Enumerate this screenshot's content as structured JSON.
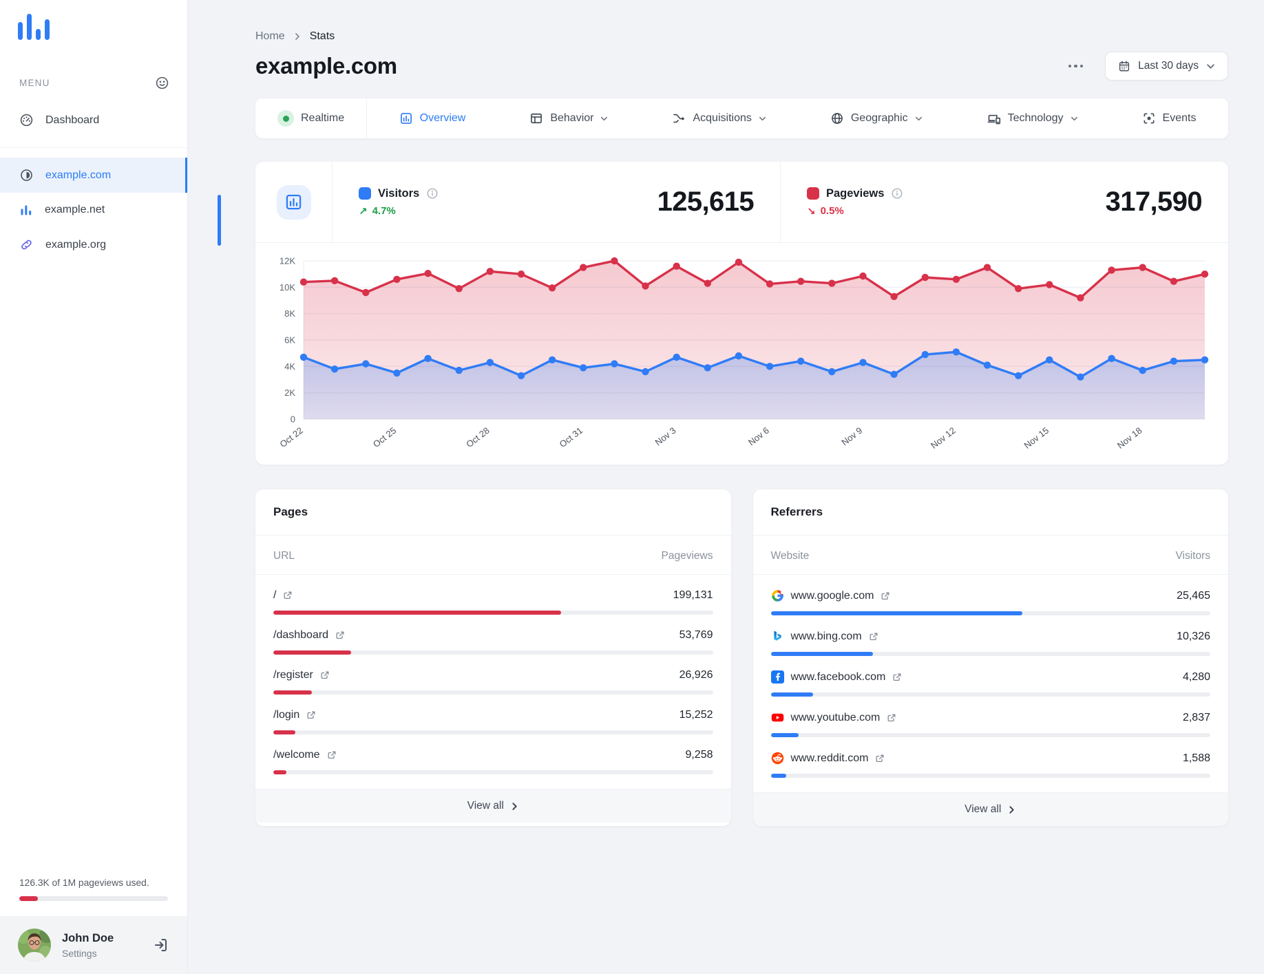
{
  "sidebar": {
    "menu_label": "MENU",
    "nav": [
      {
        "label": "Dashboard"
      }
    ],
    "sites": [
      {
        "label": "example.com",
        "active": true
      },
      {
        "label": "example.net",
        "active": false
      },
      {
        "label": "example.org",
        "active": false
      }
    ],
    "usage": {
      "text": "126.3K of 1M pageviews used.",
      "percent": 12.6
    },
    "user": {
      "name": "John Doe",
      "subtitle": "Settings"
    }
  },
  "header": {
    "breadcrumb": {
      "home": "Home",
      "current": "Stats"
    },
    "title": "example.com",
    "date_button": "Last 30 days"
  },
  "tabs": [
    {
      "label": "Realtime",
      "active": false
    },
    {
      "label": "Overview",
      "active": true
    },
    {
      "label": "Behavior",
      "active": false,
      "chevron": true
    },
    {
      "label": "Acquisitions",
      "active": false,
      "chevron": true
    },
    {
      "label": "Geographic",
      "active": false,
      "chevron": true
    },
    {
      "label": "Technology",
      "active": false,
      "chevron": true
    },
    {
      "label": "Events",
      "active": false
    }
  ],
  "stats": [
    {
      "label": "Visitors",
      "value": "125,615",
      "delta": "4.7%",
      "arrow": "↗",
      "trend": "up",
      "color": "#2f7cf6"
    },
    {
      "label": "Pageviews",
      "value": "317,590",
      "delta": "0.5%",
      "arrow": "↘",
      "trend": "down",
      "color": "#d8314a"
    }
  ],
  "chart_data": {
    "type": "line",
    "title": "Visitors vs Pageviews, last 30 days",
    "x": [
      "Oct 22",
      "Oct 23",
      "Oct 24",
      "Oct 25",
      "Oct 26",
      "Oct 27",
      "Oct 28",
      "Oct 29",
      "Oct 30",
      "Oct 31",
      "Nov 1",
      "Nov 2",
      "Nov 3",
      "Nov 4",
      "Nov 5",
      "Nov 6",
      "Nov 7",
      "Nov 8",
      "Nov 9",
      "Nov 10",
      "Nov 11",
      "Nov 12",
      "Nov 13",
      "Nov 14",
      "Nov 15",
      "Nov 16",
      "Nov 17",
      "Nov 18",
      "Nov 19",
      "Nov 20"
    ],
    "series": [
      {
        "name": "Pageviews",
        "color": "#d8314a",
        "values": [
          10400,
          10500,
          9600,
          10600,
          11050,
          9900,
          11200,
          11000,
          9950,
          11500,
          12000,
          10100,
          11600,
          10300,
          11900,
          10250,
          10450,
          10300,
          10850,
          9300,
          10750,
          10600,
          11500,
          9900,
          10200,
          9200,
          11300,
          11500,
          10450,
          11000
        ]
      },
      {
        "name": "Visitors",
        "color": "#2f7cf6",
        "values": [
          4700,
          3800,
          4200,
          3500,
          4600,
          3700,
          4300,
          3300,
          4500,
          3900,
          4200,
          3600,
          4700,
          3900,
          4800,
          4000,
          4400,
          3600,
          4300,
          3400,
          4900,
          5100,
          4100,
          3300,
          4500,
          3200,
          4600,
          3700,
          4400,
          4500
        ]
      }
    ],
    "ylim": [
      0,
      12000
    ],
    "ytick_step": 2000,
    "xtick_every": 3,
    "grid": true,
    "area_fill": true,
    "legend_position": "header"
  },
  "pages_card": {
    "title": "Pages",
    "col_label": "URL",
    "col_value": "Pageviews",
    "view_all": "View all",
    "bar_color": "#d8314a",
    "rows": [
      {
        "label": "/",
        "value": "199,131"
      },
      {
        "label": "/dashboard",
        "value": "53,769"
      },
      {
        "label": "/register",
        "value": "26,926"
      },
      {
        "label": "/login",
        "value": "15,252"
      },
      {
        "label": "/welcome",
        "value": "9,258"
      }
    ]
  },
  "referrers_card": {
    "title": "Referrers",
    "col_label": "Website",
    "col_value": "Visitors",
    "view_all": "View all",
    "bar_color": "#2f7cf6",
    "rows": [
      {
        "label": "www.google.com",
        "icon": "google",
        "value": "25,465"
      },
      {
        "label": "www.bing.com",
        "icon": "bing",
        "value": "10,326"
      },
      {
        "label": "www.facebook.com",
        "icon": "facebook",
        "value": "4,280"
      },
      {
        "label": "www.youtube.com",
        "icon": "youtube",
        "value": "2,837"
      },
      {
        "label": "www.reddit.com",
        "icon": "reddit",
        "value": "1,588"
      }
    ]
  }
}
